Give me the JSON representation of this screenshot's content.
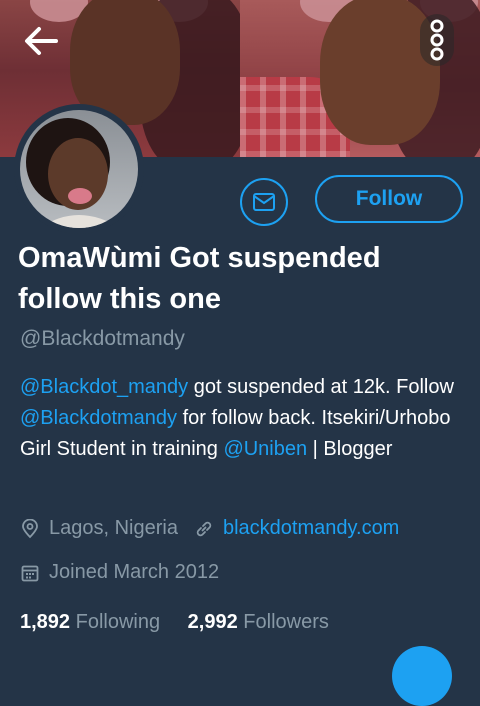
{
  "profile": {
    "display_name": "OmaWùmi Got suspended follow this one",
    "handle": "@Blackdotmandy"
  },
  "actions": {
    "follow_label": "Follow",
    "message_icon": "envelope-icon",
    "back_icon": "arrow-left-icon",
    "more_icon": "vertical-dots-icon"
  },
  "bio": {
    "mention_1": "@Blackdot_mandy",
    "text_1": " got suspended at 12k. Follow ",
    "mention_2": "@Blackdotmandy",
    "text_2": " for follow back. Itsekiri/Urhobo Girl Student in training ",
    "mention_3": "@Uniben",
    "text_3": " | Blogger"
  },
  "meta": {
    "location": "Lagos, Nigeria",
    "website": "blackdotmandy.com",
    "joined": "Joined March 2012"
  },
  "stats": {
    "following_count": "1,892",
    "following_label": "Following",
    "followers_count": "2,992",
    "followers_label": "Followers"
  },
  "colors": {
    "background": "#243447",
    "accent": "#1da1f2",
    "muted": "#8899a6"
  }
}
